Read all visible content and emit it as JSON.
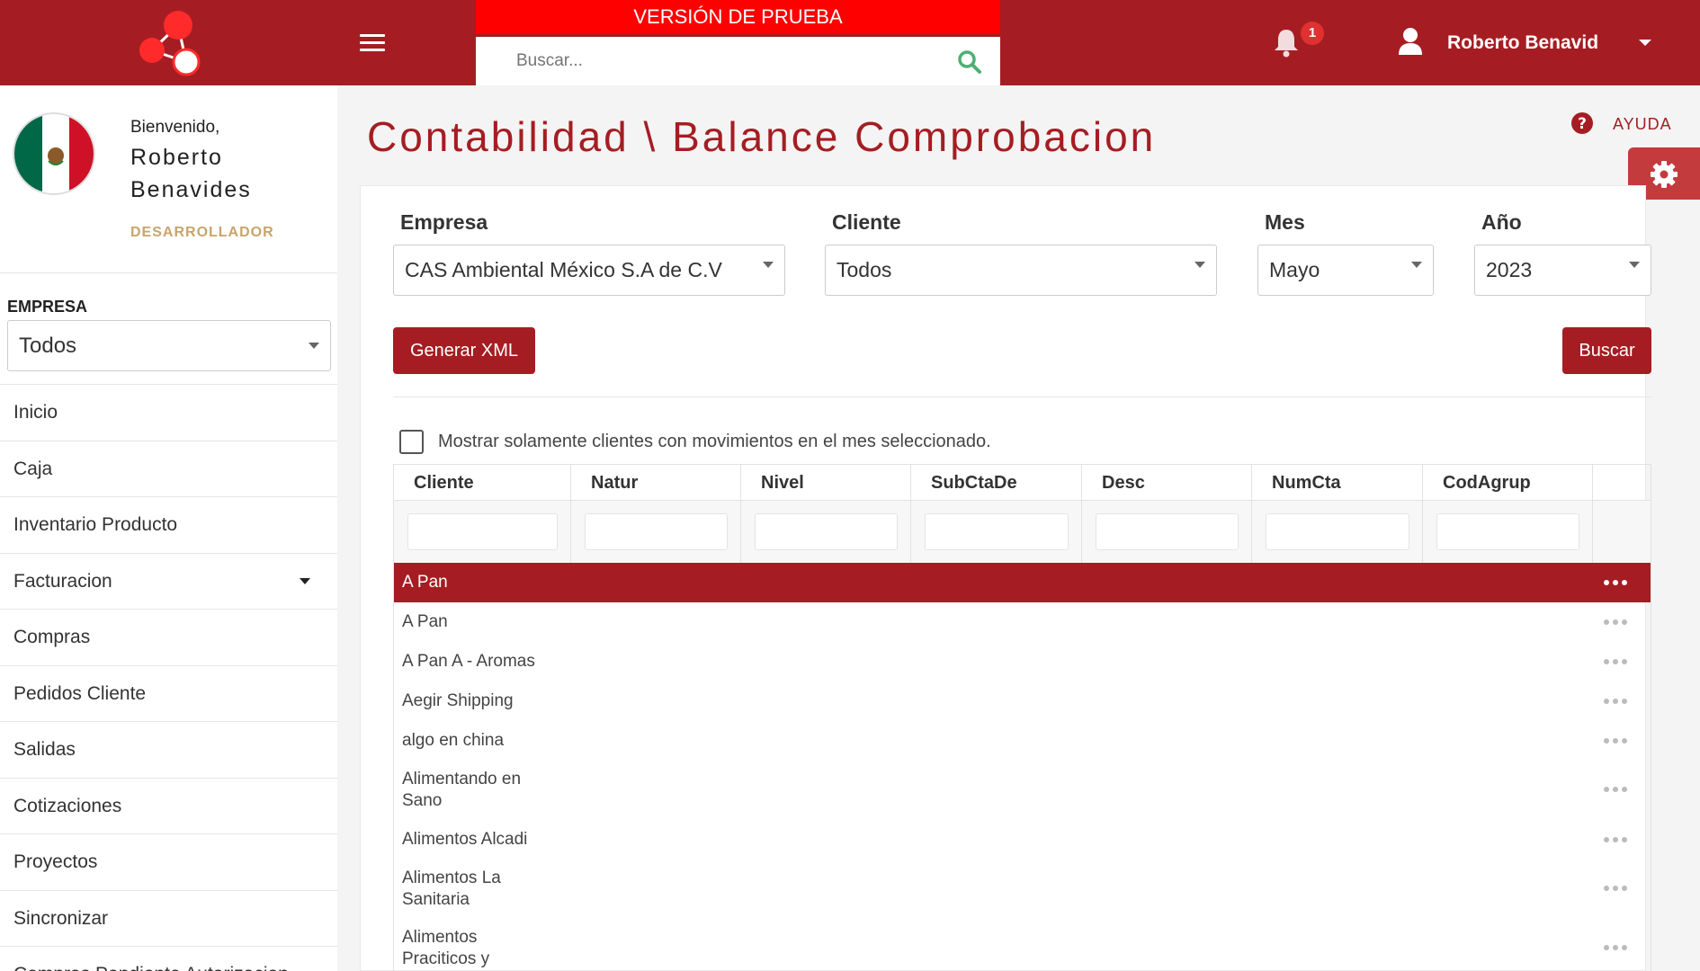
{
  "header": {
    "trial_banner": "VERSIÓN DE PRUEBA",
    "search_placeholder": "Buscar...",
    "notification_count": "1",
    "user_name": "Roberto Benavid",
    "brand_color": "#a51d22",
    "banner_color": "#ff0000"
  },
  "profile": {
    "welcome": "Bienvenido,",
    "name_line1": "Roberto",
    "name_line2": "Benavides",
    "role": "DESARROLLADOR",
    "avatar_icon": "mexico-flag"
  },
  "sidebar": {
    "empresa_label": "EMPRESA",
    "empresa_value": "Todos",
    "items": [
      {
        "label": "Inicio"
      },
      {
        "label": "Caja"
      },
      {
        "label": "Inventario Producto"
      },
      {
        "label": "Facturacion"
      },
      {
        "label": "Compras"
      },
      {
        "label": "Pedidos Cliente"
      },
      {
        "label": "Salidas"
      },
      {
        "label": "Cotizaciones"
      },
      {
        "label": "Proyectos"
      },
      {
        "label": "Sincronizar"
      },
      {
        "label": "Compras Pendiente Autorizacion"
      }
    ]
  },
  "main": {
    "title": "Contabilidad \\ Balance Comprobacion",
    "help_label": "AYUDA",
    "filters": {
      "empresa_label": "Empresa",
      "empresa_value": "CAS Ambiental México S.A de C.V",
      "cliente_label": "Cliente",
      "cliente_value": "Todos",
      "mes_label": "Mes",
      "mes_value": "Mayo",
      "anio_label": "Año",
      "anio_value": "2023"
    },
    "generate_xml_label": "Generar XML",
    "search_button_label": "Buscar",
    "checkbox_label": "Mostrar solamente clientes con movimientos en el mes seleccionado.",
    "checkbox_checked": false,
    "table": {
      "columns": [
        "Cliente",
        "Natur",
        "Nivel",
        "SubCtaDe",
        "Desc",
        "NumCta",
        "CodAgrup"
      ],
      "rows": [
        {
          "cliente": "A Pan",
          "selected": true
        },
        {
          "cliente": "A Pan"
        },
        {
          "cliente": "A Pan A - Aromas"
        },
        {
          "cliente": "Aegir Shipping"
        },
        {
          "cliente": "algo en china"
        },
        {
          "cliente": "Alimentando en Sano"
        },
        {
          "cliente": "Alimentos Alcadi"
        },
        {
          "cliente": "Alimentos La Sanitaria"
        },
        {
          "cliente": "Alimentos Praciticos y"
        }
      ]
    }
  }
}
